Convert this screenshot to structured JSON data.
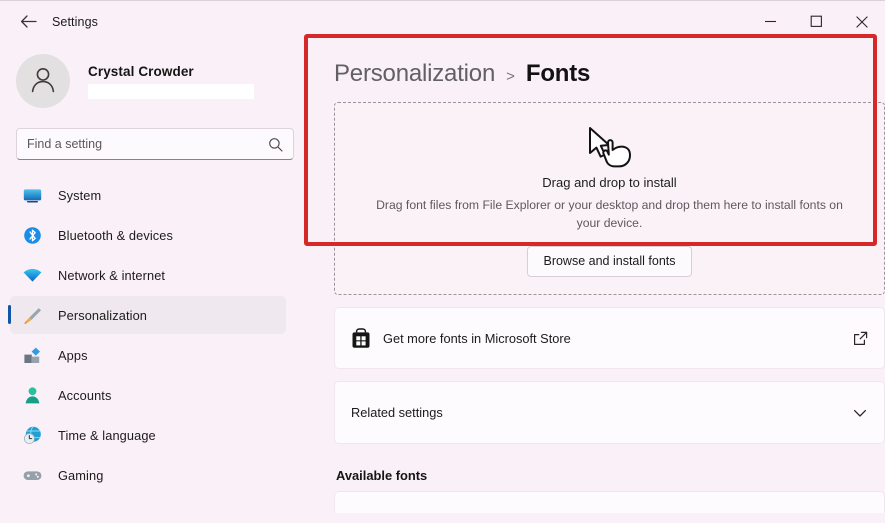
{
  "window": {
    "app_title": "Settings",
    "back_icon": "back-arrow-icon",
    "controls": [
      {
        "name": "minimize",
        "icon": "minimize-icon"
      },
      {
        "name": "maximize",
        "icon": "maximize-icon"
      },
      {
        "name": "close",
        "icon": "close-icon"
      }
    ]
  },
  "account": {
    "name": "Crystal Crowder",
    "email_redacted": "",
    "avatar_icon": "person-avatar-icon"
  },
  "search": {
    "placeholder": "Find a setting",
    "value": "",
    "icon": "search-icon"
  },
  "sidebar": {
    "items": [
      {
        "label": "System",
        "icon": "monitor-icon",
        "selected": false
      },
      {
        "label": "Bluetooth & devices",
        "icon": "bluetooth-icon",
        "selected": false
      },
      {
        "label": "Network & internet",
        "icon": "wifi-icon",
        "selected": false
      },
      {
        "label": "Personalization",
        "icon": "paintbrush-icon",
        "selected": true
      },
      {
        "label": "Apps",
        "icon": "apps-icon",
        "selected": false
      },
      {
        "label": "Accounts",
        "icon": "account-icon",
        "selected": false
      },
      {
        "label": "Time & language",
        "icon": "clock-globe-icon",
        "selected": false
      },
      {
        "label": "Gaming",
        "icon": "gamepad-icon",
        "selected": false
      }
    ]
  },
  "breadcrumb": {
    "parent": "Personalization",
    "separator": ">",
    "current": "Fonts"
  },
  "dropzone": {
    "cursor_icon": "drag-drop-cursor-icon",
    "title": "Drag and drop to install",
    "description": "Drag font files from File Explorer or your desktop and drop them here to install fonts on your device.",
    "button_label": "Browse and install fonts",
    "highlight_color": "#d62828"
  },
  "cards": {
    "store": {
      "label": "Get more fonts in Microsoft Store",
      "icon": "microsoft-store-icon",
      "trailing_icon": "external-link-icon"
    },
    "related": {
      "label": "Related settings",
      "trailing_icon": "chevron-down-icon"
    }
  },
  "available_fonts": {
    "title": "Available fonts"
  },
  "colors": {
    "page_background": "#faf0f7",
    "card_background": "#fdfbfd",
    "accent": "#0f57a6",
    "annotation": "#d62828"
  }
}
